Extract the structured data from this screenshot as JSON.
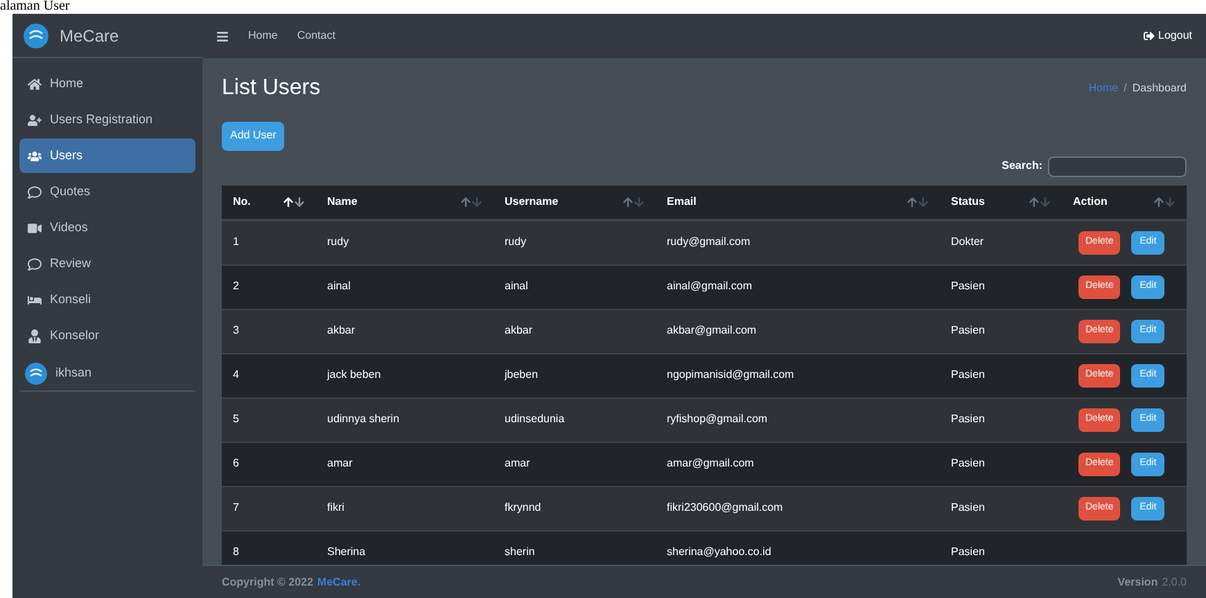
{
  "caption": "alaman User",
  "brand": {
    "name": "MeCare"
  },
  "sidebar": {
    "items": [
      {
        "label": "Home",
        "kind": "home",
        "selected": false
      },
      {
        "label": "Users Registration",
        "kind": "registration",
        "selected": false
      },
      {
        "label": "Users",
        "kind": "users",
        "selected": true
      },
      {
        "label": "Quotes",
        "kind": "quotes",
        "selected": false
      },
      {
        "label": "Videos",
        "kind": "videos",
        "selected": false
      },
      {
        "label": "Review",
        "kind": "review",
        "selected": false
      },
      {
        "label": "Konseli",
        "kind": "konseli",
        "selected": false
      },
      {
        "label": "Konselor",
        "kind": "konselor",
        "selected": false
      }
    ],
    "user": "ikhsan"
  },
  "navbar": {
    "links": [
      "Home",
      "Contact"
    ],
    "logout": "Logout"
  },
  "page_title": "List Users",
  "breadcrumb": {
    "link": "Home",
    "separator": "/",
    "current": "Dashboard"
  },
  "add_button": "Add User",
  "search": {
    "label": "Search:"
  },
  "table": {
    "columns": [
      {
        "label": "No.",
        "sorted": true
      },
      {
        "label": "Name",
        "sorted": false
      },
      {
        "label": "Username",
        "sorted": false
      },
      {
        "label": "Email",
        "sorted": false
      },
      {
        "label": "Status",
        "sorted": false
      },
      {
        "label": "Action",
        "sorted": false
      }
    ],
    "rows": [
      {
        "cells": [
          "1",
          "rudy",
          "rudy",
          "rudy@gmail.com",
          "Dokter"
        ],
        "actions": [
          "Delete",
          "Edit"
        ]
      },
      {
        "cells": [
          "2",
          "ainal",
          "ainal",
          "ainal@gmail.com",
          "Pasien"
        ],
        "actions": [
          "Delete",
          "Edit"
        ]
      },
      {
        "cells": [
          "3",
          "akbar",
          "akbar",
          "akbar@gmail.com",
          "Pasien"
        ],
        "actions": [
          "Delete",
          "Edit"
        ]
      },
      {
        "cells": [
          "4",
          "jack beben",
          "jbeben",
          "ngopimanisid@gmail.com",
          "Pasien"
        ],
        "actions": [
          "Delete",
          "Edit"
        ]
      },
      {
        "cells": [
          "5",
          "udinnya sherin",
          "udinsedunia",
          "ryfishop@gmail.com",
          "Pasien"
        ],
        "actions": [
          "Delete",
          "Edit"
        ]
      },
      {
        "cells": [
          "6",
          "amar",
          "amar",
          "amar@gmail.com",
          "Pasien"
        ],
        "actions": [
          "Delete",
          "Edit"
        ]
      },
      {
        "cells": [
          "7",
          "fikri",
          "fkrynnd",
          "fikri230600@gmail.com",
          "Pasien"
        ],
        "actions": [
          "Delete",
          "Edit"
        ]
      },
      {
        "cells": [
          "8",
          "Sherina",
          "sherin",
          "sherina@yahoo.co.id",
          "Pasien"
        ],
        "actions": []
      }
    ]
  },
  "footer": {
    "copyright": "Copyright © 2022",
    "brand": "MeCare.",
    "version_label": "Version",
    "version": "2.0.0"
  }
}
